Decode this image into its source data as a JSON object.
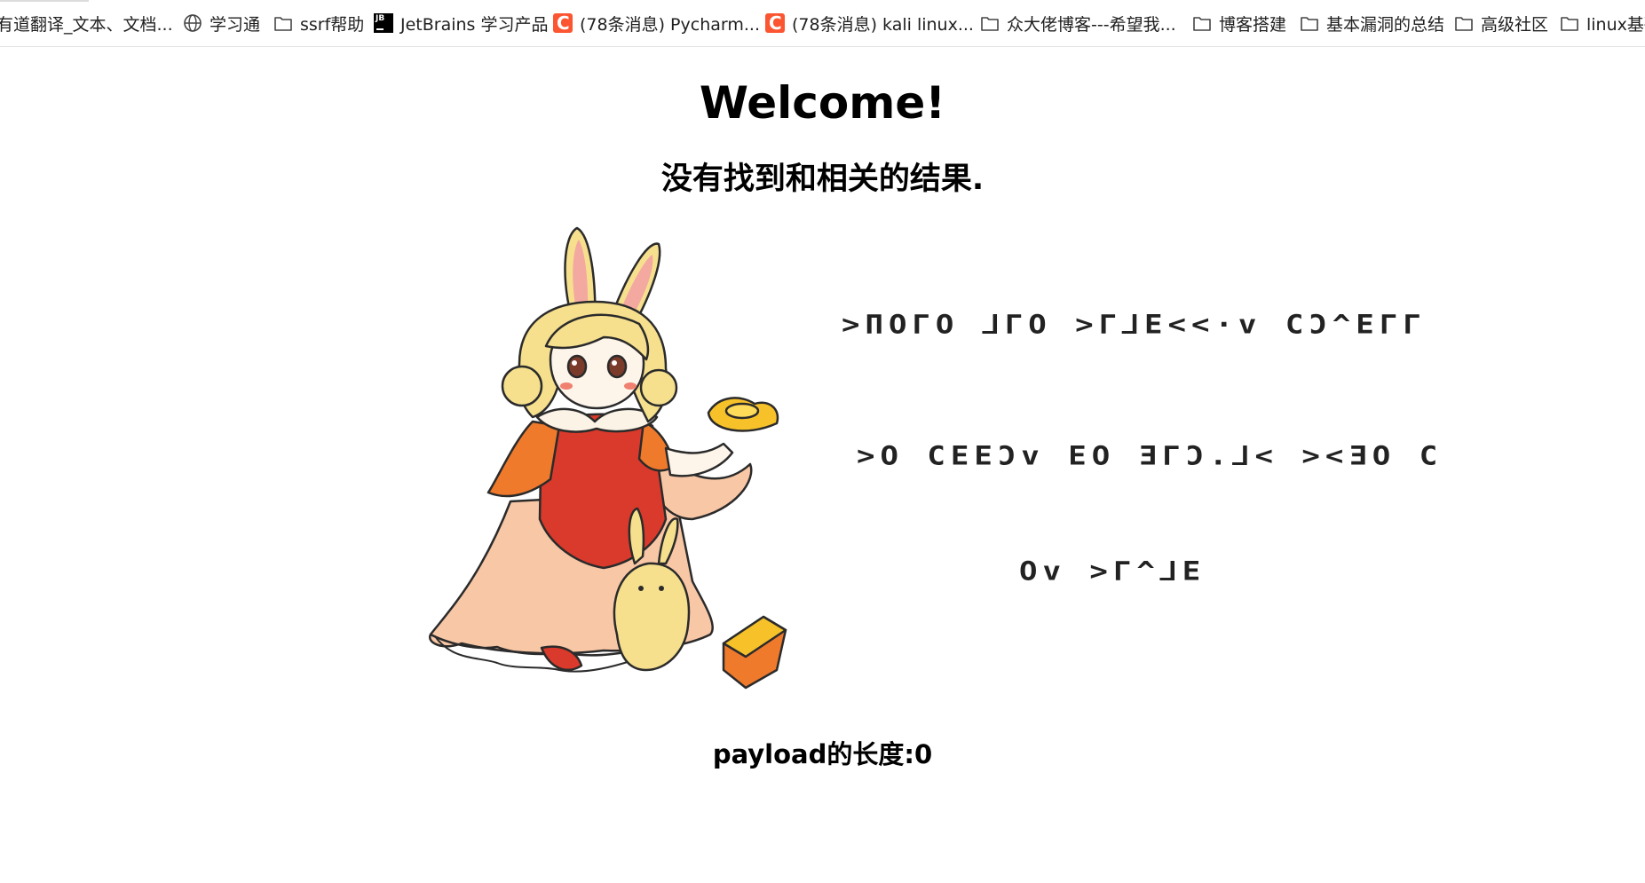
{
  "bookmarks": [
    {
      "label": "有道翻译_文本、文档...",
      "icon": "none"
    },
    {
      "label": "学习通",
      "icon": "globe-icon"
    },
    {
      "label": "ssrf帮助",
      "icon": "folder-icon"
    },
    {
      "label": "JetBrains 学习产品",
      "icon": "jetbrains-icon"
    },
    {
      "label": "(78条消息) Pycharm...",
      "icon": "csdn-icon"
    },
    {
      "label": "(78条消息) kali linux...",
      "icon": "csdn-icon"
    },
    {
      "label": "众大佬博客---希望我...",
      "icon": "folder-icon"
    },
    {
      "label": "博客搭建",
      "icon": "folder-icon"
    },
    {
      "label": "基本漏洞的总结",
      "icon": "folder-icon"
    },
    {
      "label": "高级社区",
      "icon": "folder-icon"
    },
    {
      "label": "linux基础",
      "icon": "folder-icon"
    }
  ],
  "page": {
    "heading": "Welcome!",
    "search_result": "没有找到和相关的结果.",
    "payload_text": "payload的长度:0"
  },
  "cipher": {
    "line1": ">ΠOΓO ⅃ΓO >Γ⅃E<<·v CƆ^EΓΓ",
    "line2": ">O CEEƆv EO ƎΓƆ.⅃< ><ƎO C",
    "line3": "Ov >Γ^⅃E"
  },
  "colors": {
    "jetbrains": "#000000",
    "csdn": "#fc5531",
    "text": "#000000"
  }
}
